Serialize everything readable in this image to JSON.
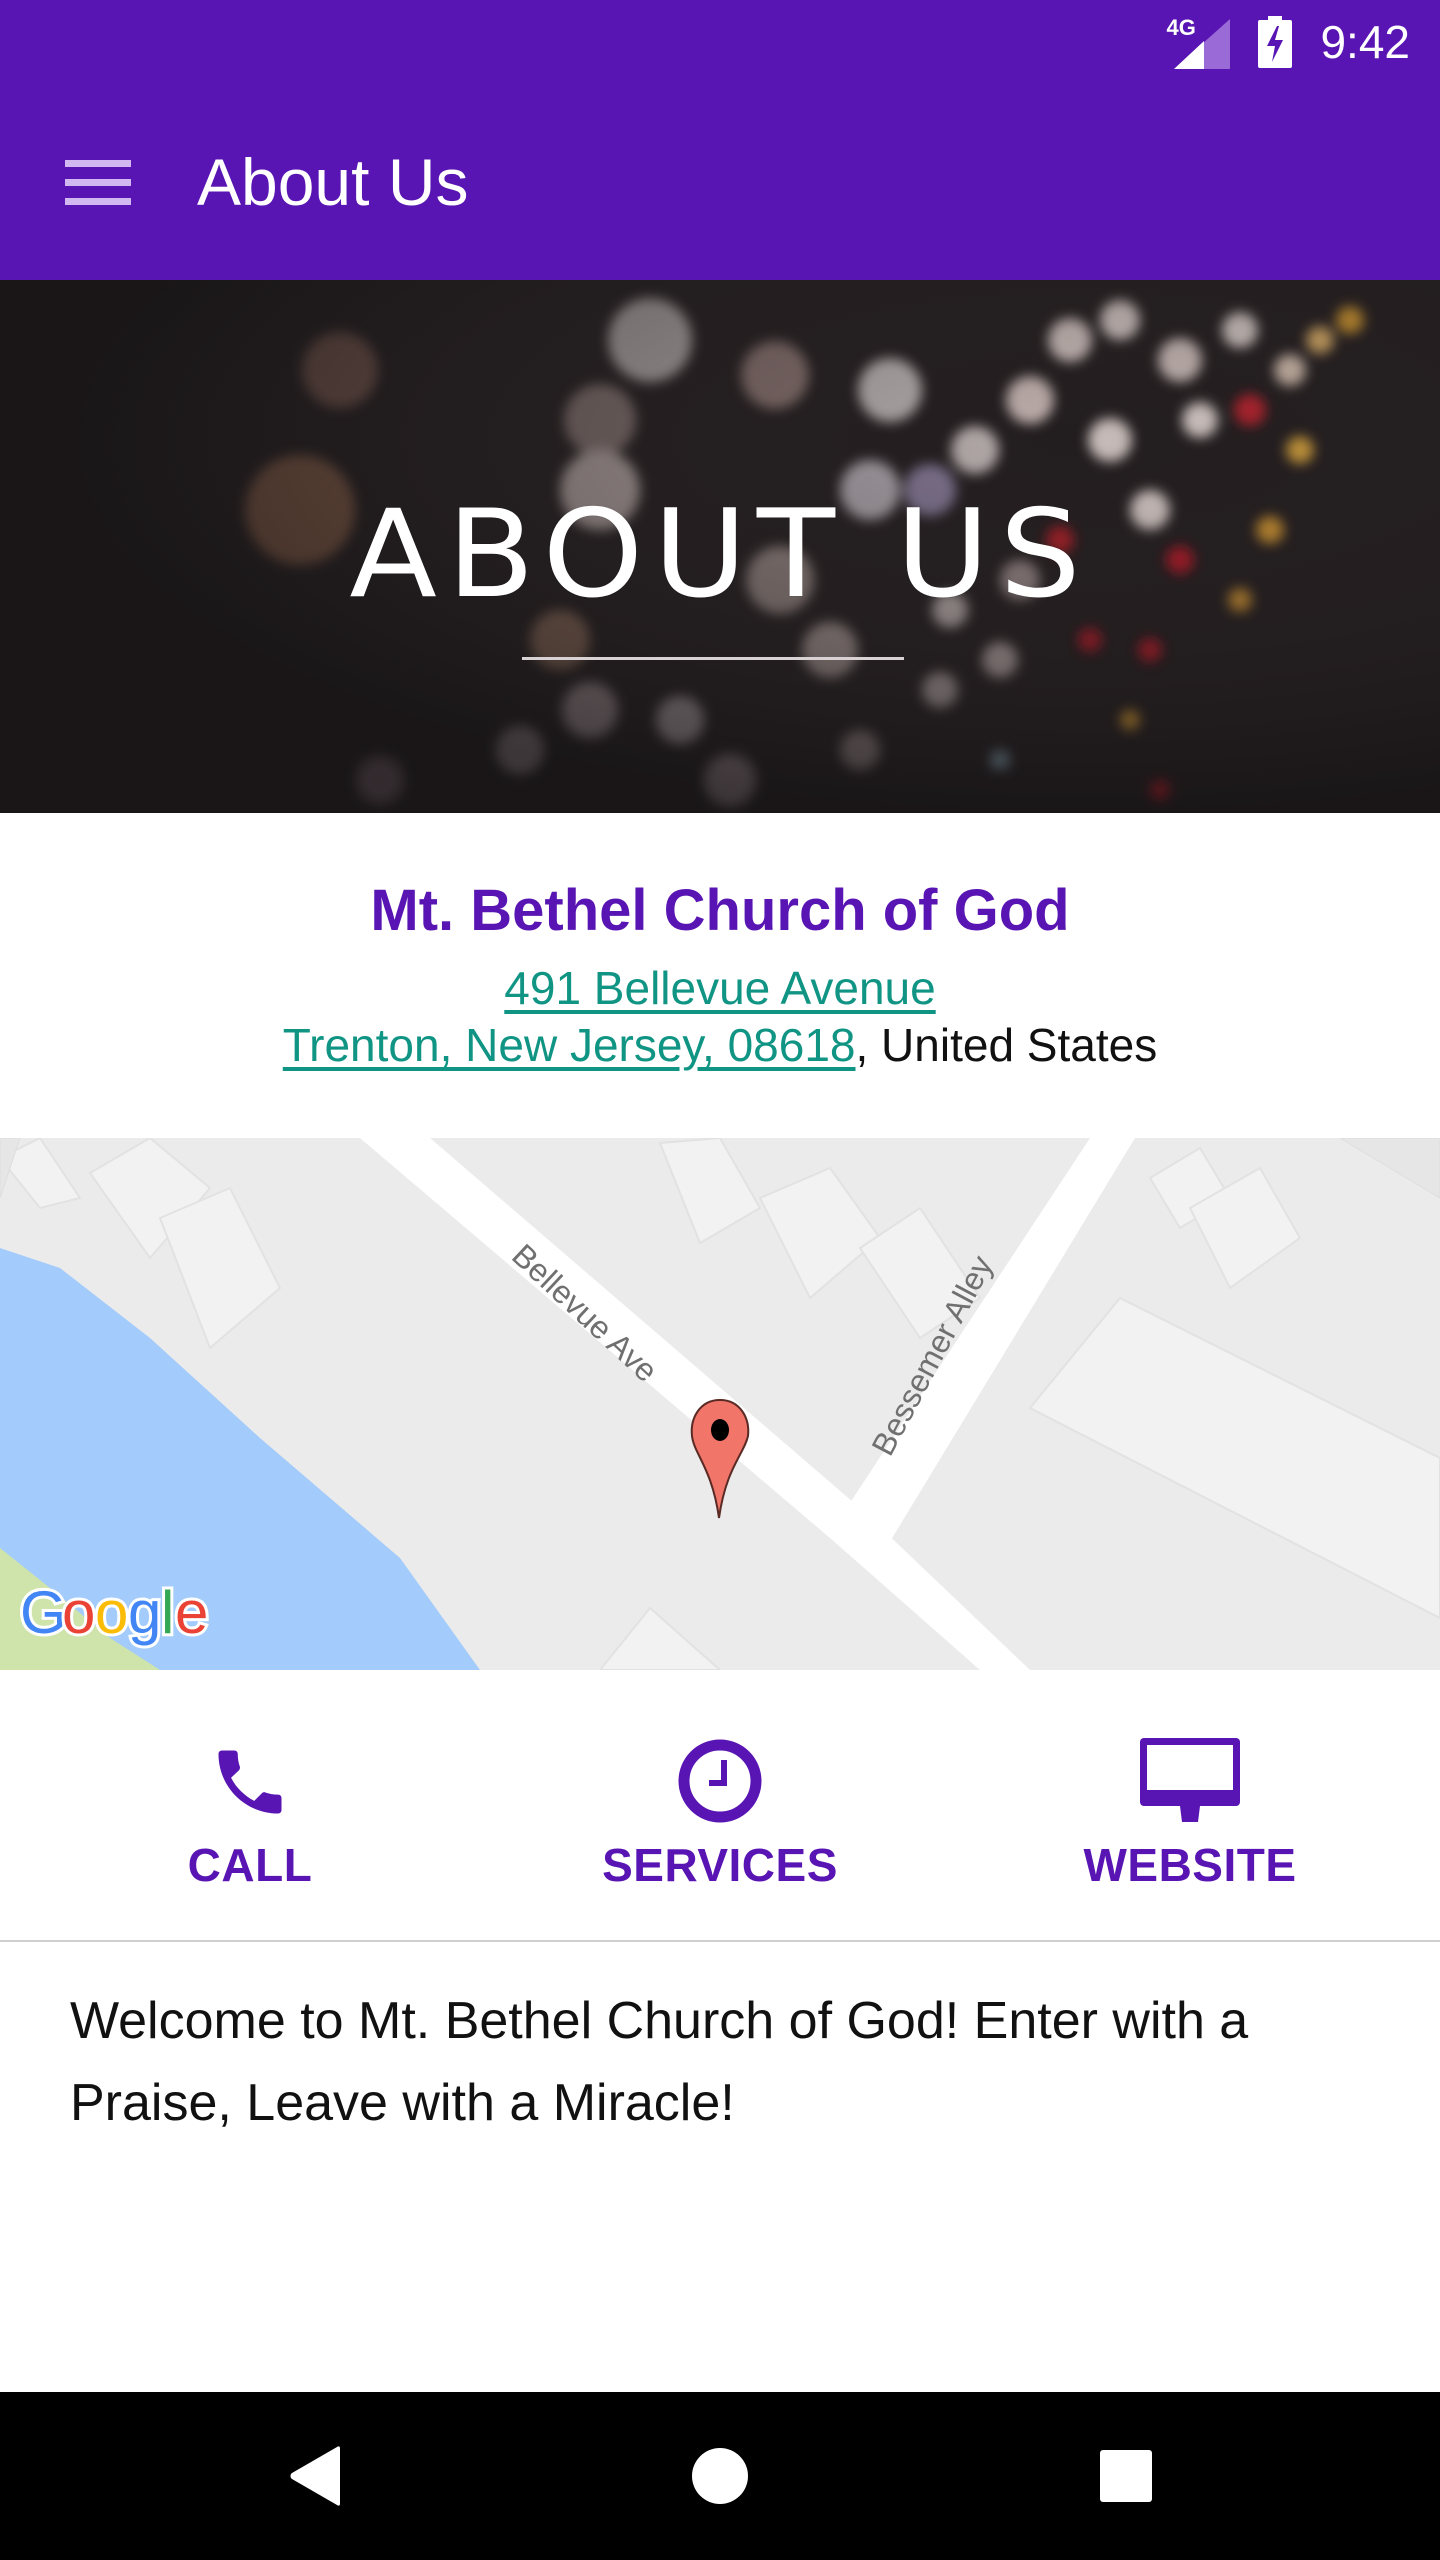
{
  "status_bar": {
    "network_label": "4G",
    "time": "9:42",
    "icons": [
      "signal-icon",
      "battery-charging-icon"
    ]
  },
  "app_bar": {
    "menu_icon": "hamburger-menu-icon",
    "title": "About Us"
  },
  "hero": {
    "title": "ABOUT US"
  },
  "info": {
    "church_name": "Mt. Bethel Church of God",
    "address_line1": "491 Bellevue Avenue",
    "address_line2_link": "Trenton, New Jersey, 08618",
    "address_line2_suffix": ", United States"
  },
  "map": {
    "street_labels": [
      "Bellevue Ave",
      "Bessemer Alley"
    ],
    "attribution": "Google",
    "marker_icon": "map-pin-icon"
  },
  "actions": [
    {
      "label": "CALL",
      "icon": "phone-icon"
    },
    {
      "label": "SERVICES",
      "icon": "clock-icon"
    },
    {
      "label": "WEBSITE",
      "icon": "desktop-icon"
    }
  ],
  "welcome_text": "Welcome to Mt. Bethel Church of God!  Enter with a Praise, Leave with a Miracle!",
  "nav_bar": {
    "buttons": [
      "back-icon",
      "home-icon",
      "recents-icon"
    ]
  },
  "colors": {
    "primary": "#5915b3",
    "link": "#109483",
    "text": "#111111"
  }
}
